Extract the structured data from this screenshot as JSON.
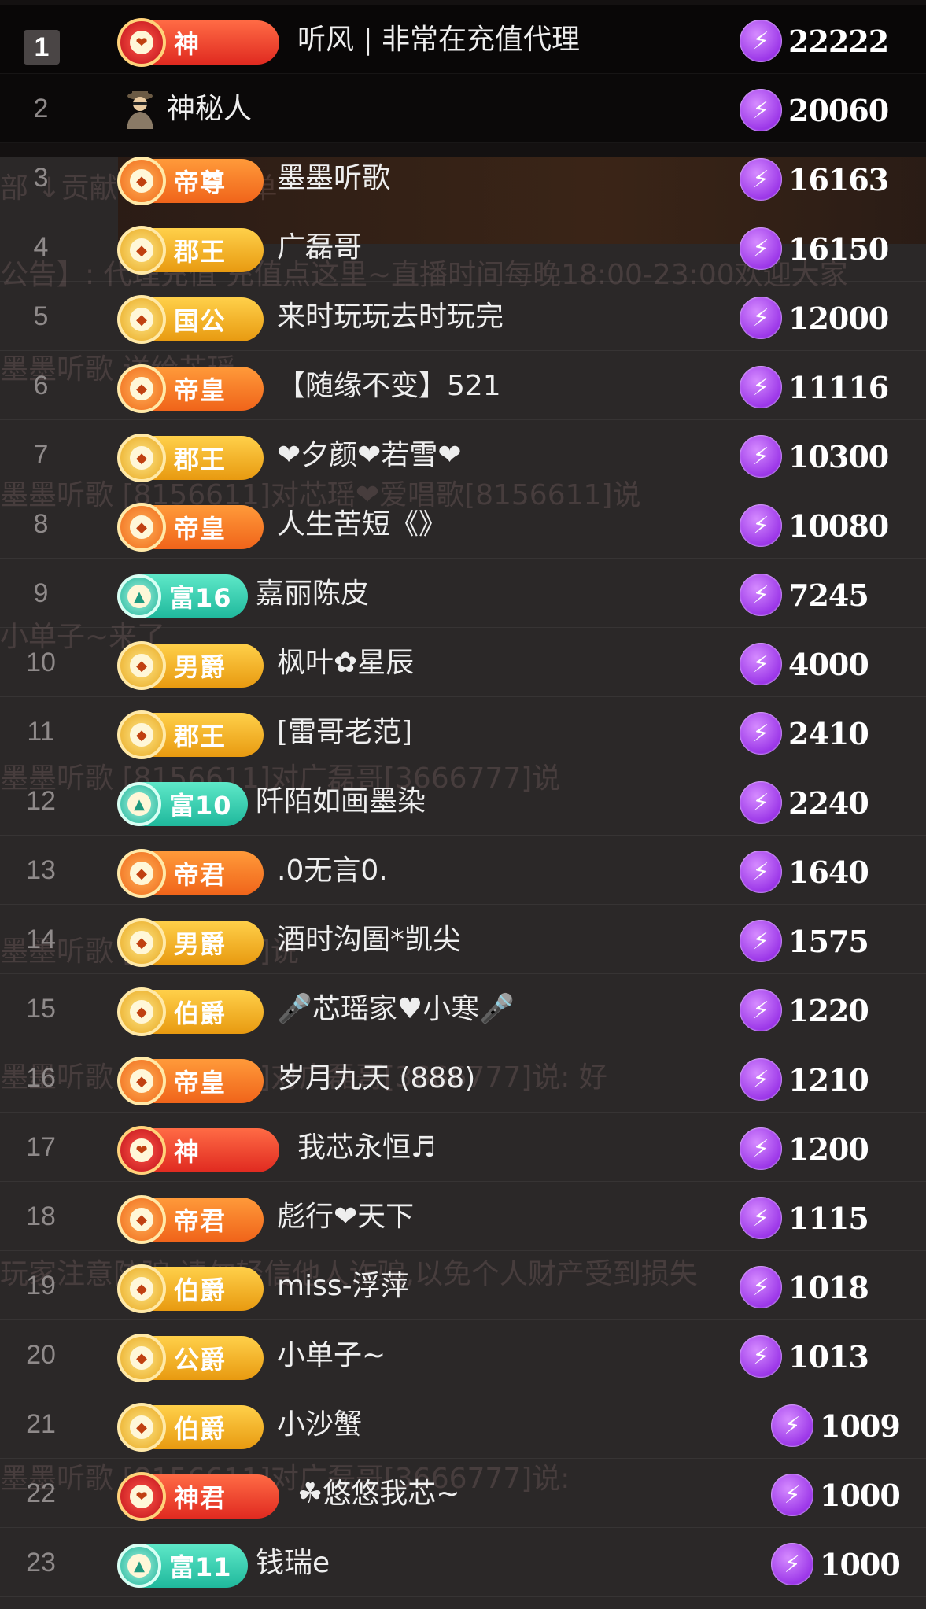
{
  "rows": [
    {
      "rank": "1",
      "badge": "神",
      "badge_style": "red",
      "name": "听风 | 非常在充值代理",
      "score": "22222"
    },
    {
      "rank": "2",
      "badge": "",
      "badge_style": "none",
      "name": "神秘人",
      "score": "20060"
    },
    {
      "rank": "3",
      "badge": "帝尊",
      "badge_style": "orange",
      "name": "墨墨听歌",
      "score": "16163"
    },
    {
      "rank": "4",
      "badge": "郡王",
      "badge_style": "gold",
      "name": "广磊哥",
      "score": "16150"
    },
    {
      "rank": "5",
      "badge": "国公",
      "badge_style": "gold",
      "name": "来时玩玩去时玩完",
      "score": "12000"
    },
    {
      "rank": "6",
      "badge": "帝皇",
      "badge_style": "orange",
      "name": "【随缘不变】521",
      "score": "11116"
    },
    {
      "rank": "7",
      "badge": "郡王",
      "badge_style": "gold",
      "name": "❤夕颜❤若雪❤",
      "score": "10300"
    },
    {
      "rank": "8",
      "badge": "帝皇",
      "badge_style": "orange",
      "name": "人生苦短《》",
      "score": "10080"
    },
    {
      "rank": "9",
      "badge": "富16",
      "badge_style": "teal",
      "name": "嘉丽陈皮",
      "score": "7245"
    },
    {
      "rank": "10",
      "badge": "男爵",
      "badge_style": "gold",
      "name": "枫叶✿星辰",
      "score": "4000"
    },
    {
      "rank": "11",
      "badge": "郡王",
      "badge_style": "gold",
      "name": "[雷哥老范]",
      "score": "2410"
    },
    {
      "rank": "12",
      "badge": "富10",
      "badge_style": "teal",
      "name": "阡陌如画墨染",
      "score": "2240"
    },
    {
      "rank": "13",
      "badge": "帝君",
      "badge_style": "orange",
      "name": ".0无言0.",
      "score": "1640"
    },
    {
      "rank": "14",
      "badge": "男爵",
      "badge_style": "gold",
      "name": "酒时沟圄*凯尖",
      "score": "1575"
    },
    {
      "rank": "15",
      "badge": "伯爵",
      "badge_style": "gold",
      "name": "🎤芯瑶家♥小寒🎤",
      "score": "1220"
    },
    {
      "rank": "16",
      "badge": "帝皇",
      "badge_style": "orange",
      "name": "岁月九天 (888)",
      "score": "1210"
    },
    {
      "rank": "17",
      "badge": "神",
      "badge_style": "red",
      "name": "我芯永恒♬",
      "score": "1200"
    },
    {
      "rank": "18",
      "badge": "帝君",
      "badge_style": "orange",
      "name": "彪行❤天下",
      "score": "1115"
    },
    {
      "rank": "19",
      "badge": "伯爵",
      "badge_style": "gold",
      "name": "miss-浮萍",
      "score": "1018"
    },
    {
      "rank": "20",
      "badge": "公爵",
      "badge_style": "gold",
      "name": "小单子~",
      "score": "1013"
    },
    {
      "rank": "21",
      "badge": "伯爵",
      "badge_style": "gold",
      "name": "小沙蟹",
      "score": "1009"
    },
    {
      "rank": "22",
      "badge": "神君",
      "badge_style": "red",
      "name": "☘悠悠我芯~",
      "score": "1000"
    },
    {
      "rank": "23",
      "badge": "富11",
      "badge_style": "teal",
      "name": "钱瑞e",
      "score": "1000"
    }
  ],
  "bg_ghost_lines": [
    "部      ↓贡献         点才艺           礼单",
    "公告】:  代理充值 充值点这里~直播时间每晚18:00-23:00欢迎大家",
    "墨墨听歌                        送给芯瑶",
    "墨墨听歌  [8156611]对芯瑶❤爱唱歌[8156611]说",
    "小单子~来了",
    "墨墨听歌 [8156611]对广磊哥[3666777]说",
    "墨墨听歌 [8156611]说",
    "墨墨听歌 [8156611]对广磊哥[3666777]说: 好",
    "玩家注意防骗 请勿轻信他人诈骗,以免个人财产受到损失",
    "墨墨听歌 [8156611]对广磊哥[3666777]说:"
  ],
  "colors": {
    "background": "#2b2828",
    "top_band": "#141111",
    "score_icon": "#9b36e8",
    "text": "#eeeeee",
    "rank_text": "#8f8a8a"
  },
  "icons": {
    "score": "lightning-bolt-icon",
    "badge_emblem": "rank-emblem-icon",
    "mystery_user": "mystery-person-icon"
  }
}
